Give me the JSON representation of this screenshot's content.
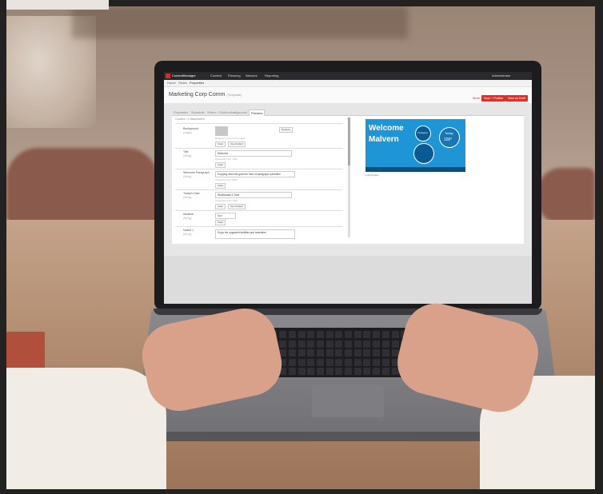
{
  "app": {
    "name": "ContentManager",
    "nav": [
      "Content",
      "Planning",
      "Network",
      "Reporting"
    ],
    "user": "Administrator"
  },
  "breadcrumb": [
    "Home",
    "Slides",
    "Properties"
  ],
  "page": {
    "title": "Marketing Corp Comm",
    "subtitle": "(Template)",
    "actions": {
      "link": "More",
      "primary": "Save + Publish",
      "secondary": "Save as Draft"
    }
  },
  "tabs": [
    "Properties",
    "Schedule",
    "Where / Distribution",
    "Approval",
    "Preview"
  ],
  "active_tab": "Preview",
  "form": {
    "heading": "Content - 1 Attachment",
    "fields": [
      {
        "label": "Background",
        "type": "(Image)",
        "value": "",
        "hint": "Replace / remove the image",
        "buttons": [
          "Clear",
          "Use Default"
        ]
      },
      {
        "label": "Title",
        "type": "(String)",
        "value": "Welcome",
        "hint": "Characters left: 7000",
        "buttons": [
          "Clear"
        ]
      },
      {
        "label": "Welcome Paragraph",
        "type": "(String)",
        "value": "Enjoying view lets grab the front of paragraph sometime",
        "hint": "Characters left: 5000",
        "buttons": [
          "Clear"
        ]
      },
      {
        "label": "Today's Date",
        "type": "(String)",
        "value": "Wednesday 6 June",
        "hint": "Characters left: 7000",
        "buttons": [
          "Clear",
          "Use Default"
        ]
      },
      {
        "label": "Weather",
        "type": "(String)",
        "value": "Sun",
        "hint": "",
        "buttons": [
          "Clear"
        ]
      },
      {
        "label": "Notice 1",
        "type": "(String)",
        "value": "Enjoy the upgraded facilities and amenities",
        "hint": "",
        "buttons": []
      }
    ],
    "replace_button": "Replace"
  },
  "preview": {
    "welcome": "Welcome",
    "place": "Malvern",
    "today": "Today",
    "temp": "100°",
    "circle_label": "13 degrees",
    "caption": "Full Preview"
  },
  "colors": {
    "accent_red": "#d9322b",
    "preview_blue": "#1e95d4",
    "topbar": "#2a2a2e"
  }
}
